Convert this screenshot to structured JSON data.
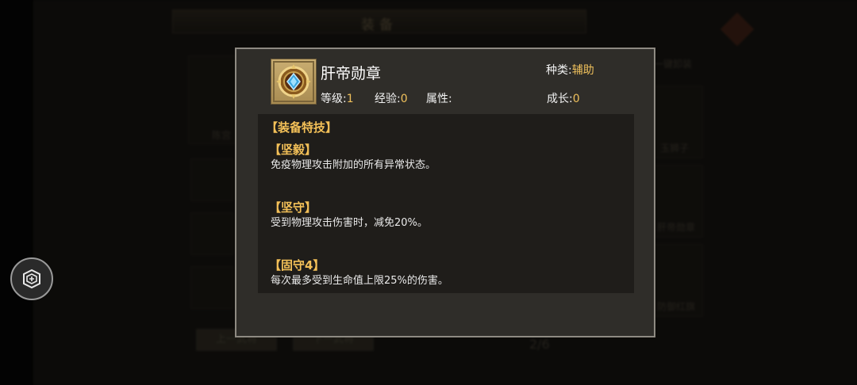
{
  "background": {
    "title": "装备",
    "hero_name": "陈宫",
    "buttons": {
      "prev_hero": "上一武将",
      "next_hero": "下一武将"
    },
    "pager": "2/6",
    "right_items": [
      "一键卸装",
      "玉狮子",
      "肝帝勋章",
      "防御红旗"
    ]
  },
  "item": {
    "name": "肝帝勋章",
    "type_label": "种类:",
    "type_value": "辅助",
    "level_label": "等级:",
    "level_value": "1",
    "exp_label": "经验:",
    "exp_value": "0",
    "attr_label": "属性:",
    "growth_label": "成长:",
    "growth_value": "0",
    "icon": "medal-icon"
  },
  "skills": {
    "section_title": "【装备特技】",
    "list": [
      {
        "name": "【坚毅】",
        "desc": "免疫物理攻击附加的所有异常状态。"
      },
      {
        "name": "【坚守】",
        "desc": "受到物理攻击伤害时，减免20%。"
      },
      {
        "name": "【固守4】",
        "desc": "每次最多受到生命值上限25%的伤害。"
      }
    ]
  },
  "colors": {
    "accent": "#f3c058",
    "dialog_bg": "#2f2d29",
    "dialog_border": "#8e8a82"
  },
  "floating_button_icon": "game-assistant-icon"
}
